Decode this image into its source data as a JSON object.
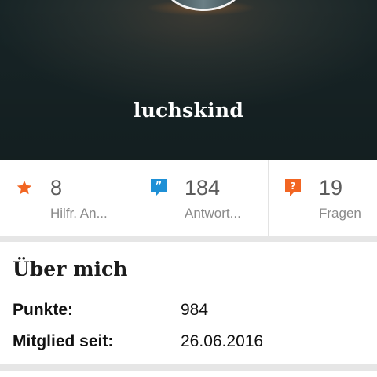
{
  "profile": {
    "username": "luchskind"
  },
  "stats": [
    {
      "value": "8",
      "label": "Hilfr. An...",
      "icon": "star-icon",
      "color": "#f26522"
    },
    {
      "value": "184",
      "label": "Antwort...",
      "icon": "quote-bubble-icon",
      "color": "#1e90d6"
    },
    {
      "value": "19",
      "label": "Fragen",
      "icon": "question-bubble-icon",
      "color": "#f26522"
    }
  ],
  "about": {
    "title": "Über mich",
    "points_label": "Punkte:",
    "points_value": "984",
    "member_label": "Mitglied seit:",
    "member_value": "26.06.2016"
  }
}
